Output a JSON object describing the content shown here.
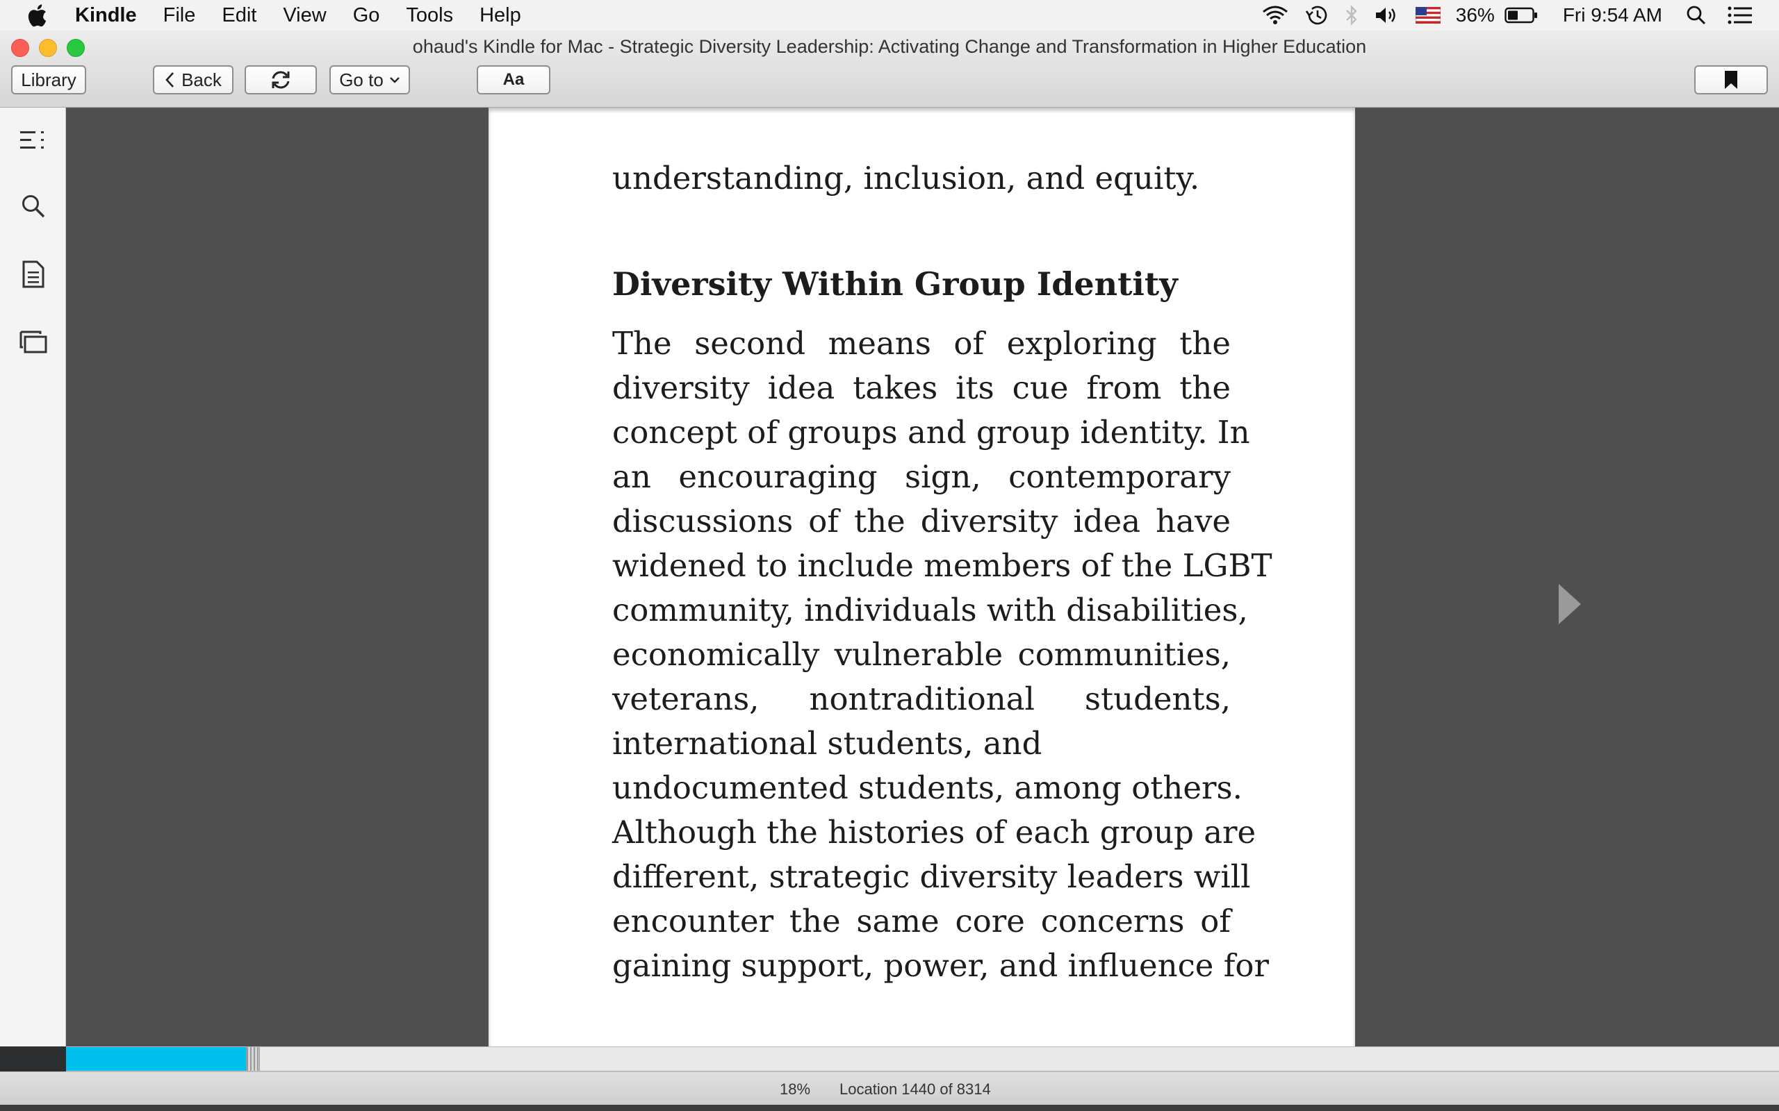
{
  "menubar": {
    "app_name": "Kindle",
    "items": [
      "File",
      "Edit",
      "View",
      "Go",
      "Tools",
      "Help"
    ],
    "battery_percent": "36%",
    "clock": "Fri 9:54 AM"
  },
  "window": {
    "title": "ohaud's Kindle for Mac - Strategic Diversity Leadership: Activating Change and Transformation in Higher Education"
  },
  "toolbar": {
    "library_label": "Library",
    "back_label": "Back",
    "goto_label": "Go to",
    "font_label": "Aa"
  },
  "sidebar": {
    "icons": [
      "table-of-contents-icon",
      "search-icon",
      "notes-icon",
      "flashcards-icon"
    ]
  },
  "page": {
    "lead_line": "understanding, inclusion, and equity.",
    "heading": "Diversity Within Group Identity",
    "lines": [
      "The second means of exploring the",
      "diversity idea takes its cue from the",
      "concept of groups and group identity. In",
      "an encouraging sign, contemporary",
      "discussions of the diversity idea have",
      "widened to include members of the LGBT",
      "community, individuals with disabilities,",
      "economically vulnerable communities,",
      "veterans, nontraditional students,",
      "international students, and",
      "undocumented students, among others.",
      "Although the histories of each group are",
      "different, strategic diversity leaders will",
      "encounter the same core concerns of",
      "gaining support, power, and influence for"
    ]
  },
  "progress": {
    "fraction": 0.105,
    "percent_label": "18%",
    "location_label": "Location 1440 of 8314"
  },
  "colors": {
    "progress_fill": "#00c1ee",
    "reader_background": "#4f4f4f"
  }
}
